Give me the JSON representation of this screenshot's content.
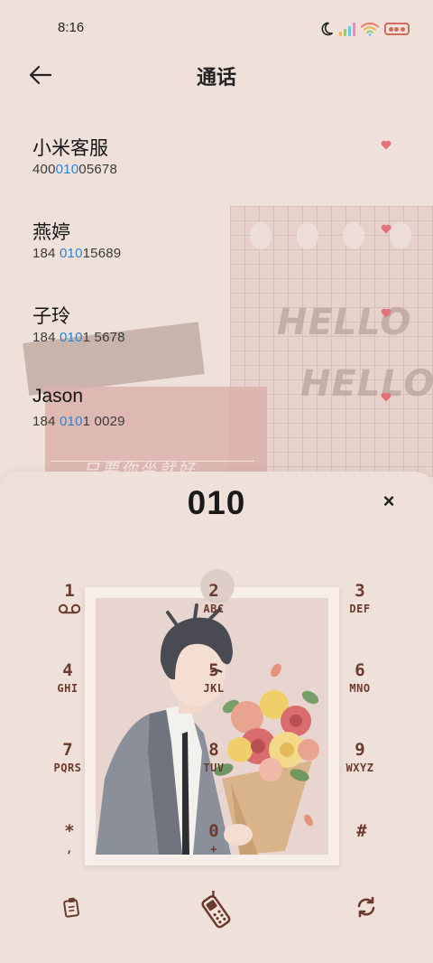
{
  "status_bar": {
    "time": "8:16",
    "icons": [
      "moon-icon",
      "signal-icon",
      "wifi-icon",
      "battery-icon"
    ]
  },
  "header": {
    "title": "通话",
    "back_icon": "arrow-left-icon"
  },
  "colors": {
    "background": "#efe1da",
    "match_highlight": "#2a84d8",
    "key_text": "#6b3a2c",
    "heart": "#e2727a"
  },
  "contacts": [
    {
      "name": "小米客服",
      "number_pre": "400",
      "number_match": "010",
      "number_post": "05678"
    },
    {
      "name": "燕婷",
      "number_pre": "184 ",
      "number_match": "010",
      "number_post": "15689"
    },
    {
      "name": "子玲",
      "number_pre": "184 ",
      "number_match": "010",
      "number_post": "1 5678"
    },
    {
      "name": "Jason",
      "number_pre": "184 ",
      "number_match": "010",
      "number_post": "1 0029"
    }
  ],
  "decoration": {
    "hello_1": "HELLO",
    "hello_2": "HELLO",
    "card_text": "只要你坐就好"
  },
  "dialer": {
    "input": "010",
    "clear_glyph": "×",
    "keys": [
      {
        "digit": "1",
        "letters": ""
      },
      {
        "digit": "2",
        "letters": "ABC"
      },
      {
        "digit": "3",
        "letters": "DEF"
      },
      {
        "digit": "4",
        "letters": "GHI"
      },
      {
        "digit": "5",
        "letters": "JKL"
      },
      {
        "digit": "6",
        "letters": "MNO"
      },
      {
        "digit": "7",
        "letters": "PQRS"
      },
      {
        "digit": "8",
        "letters": "TUV"
      },
      {
        "digit": "9",
        "letters": "WXYZ"
      },
      {
        "digit": "*",
        "letters": ","
      },
      {
        "digit": "0",
        "letters": "+"
      },
      {
        "digit": "#",
        "letters": ""
      }
    ]
  },
  "actions": {
    "left_icon": "clipboard-icon",
    "center_icon": "call-icon",
    "right_icon": "sync-icon"
  }
}
